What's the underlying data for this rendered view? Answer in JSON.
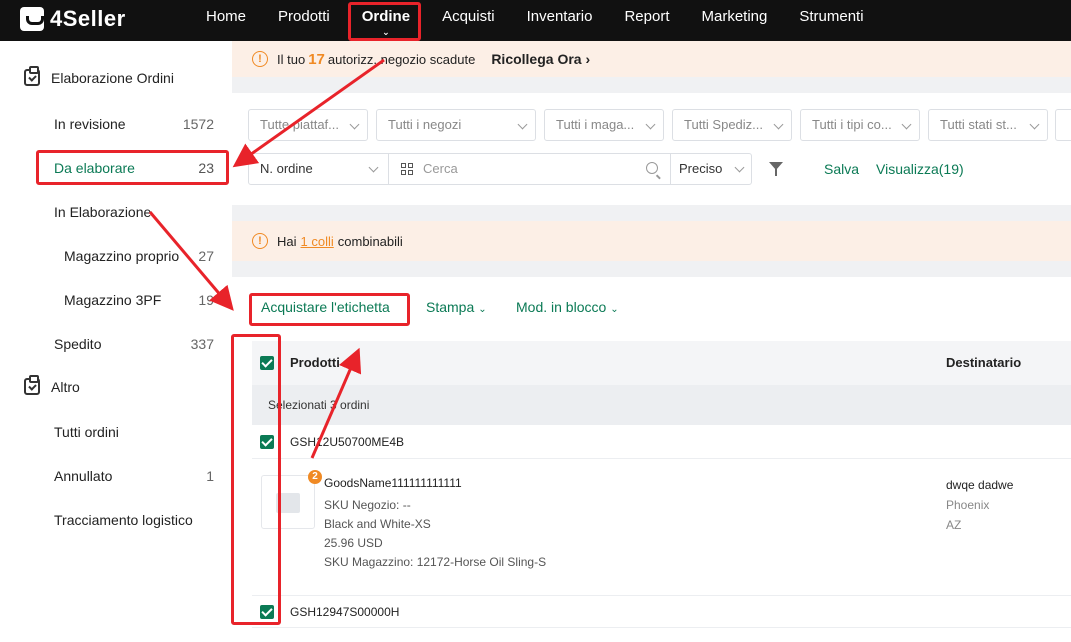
{
  "app": {
    "logo_text": "4Seller"
  },
  "nav": {
    "items": [
      "Home",
      "Prodotti",
      "Ordine",
      "Acquisti",
      "Inventario",
      "Report",
      "Marketing",
      "Strumenti"
    ],
    "active": "Ordine"
  },
  "sidebar": {
    "group_orders": "Elaborazione Ordini",
    "items": [
      {
        "label": "In revisione",
        "count": "1572"
      },
      {
        "label": "Da elaborare",
        "count": "23"
      },
      {
        "label": "In Elaborazione",
        "count": ""
      },
      {
        "label": "Magazzino proprio",
        "count": "27"
      },
      {
        "label": "Magazzino 3PF",
        "count": "19"
      },
      {
        "label": "Spedito",
        "count": "337"
      }
    ],
    "group_other": "Altro",
    "other_items": [
      {
        "label": "Tutti ordini",
        "count": ""
      },
      {
        "label": "Annullato",
        "count": "1"
      },
      {
        "label": "Tracciamento logistico",
        "count": ""
      }
    ]
  },
  "alert_top": {
    "prefix": "Il tuo",
    "number": "17",
    "suffix": "autorizz. negozio scadute",
    "link": "Ricollega Ora"
  },
  "filters": {
    "dropdowns": [
      "Tutte piattaf...",
      "Tutti i negozi",
      "Tutti i maga...",
      "Tutti Spediz...",
      "Tutti i tipi co...",
      "Tutti stati st..."
    ],
    "search_field": "N. ordine",
    "search_placeholder": "Cerca",
    "match_mode": "Preciso",
    "save_label": "Salva",
    "view_label": "Visualizza(19)"
  },
  "alert_mid": {
    "prefix": "Hai",
    "link": "1 colli",
    "suffix": "combinabili"
  },
  "toolbar": {
    "buy_label": "Acquistare l'etichetta",
    "print_label": "Stampa",
    "bulk_label": "Mod. in blocco"
  },
  "table": {
    "headers": {
      "products": "Prodotti",
      "recipient": "Destinatario"
    },
    "selected_text": "Selezionati 3 ordini",
    "orders": [
      {
        "id": "GSH12U50700ME4B",
        "badge": "2",
        "product_name": "GoodsName111111111111",
        "sku_store": "SKU Negozio: --",
        "variant": "Black and White-XS",
        "price": "25.96 USD",
        "sku_warehouse": "SKU Magazzino: 12172-Horse Oil Sling-S",
        "recipient_name": "dwqe dadwe",
        "recipient_city": "Phoenix",
        "recipient_state": "AZ"
      },
      {
        "id": "GSH12947S00000H"
      }
    ]
  },
  "colors": {
    "accent": "#0b7a55",
    "warning": "#f08a24",
    "annotation": "#e8232a",
    "topbar": "#111111"
  }
}
